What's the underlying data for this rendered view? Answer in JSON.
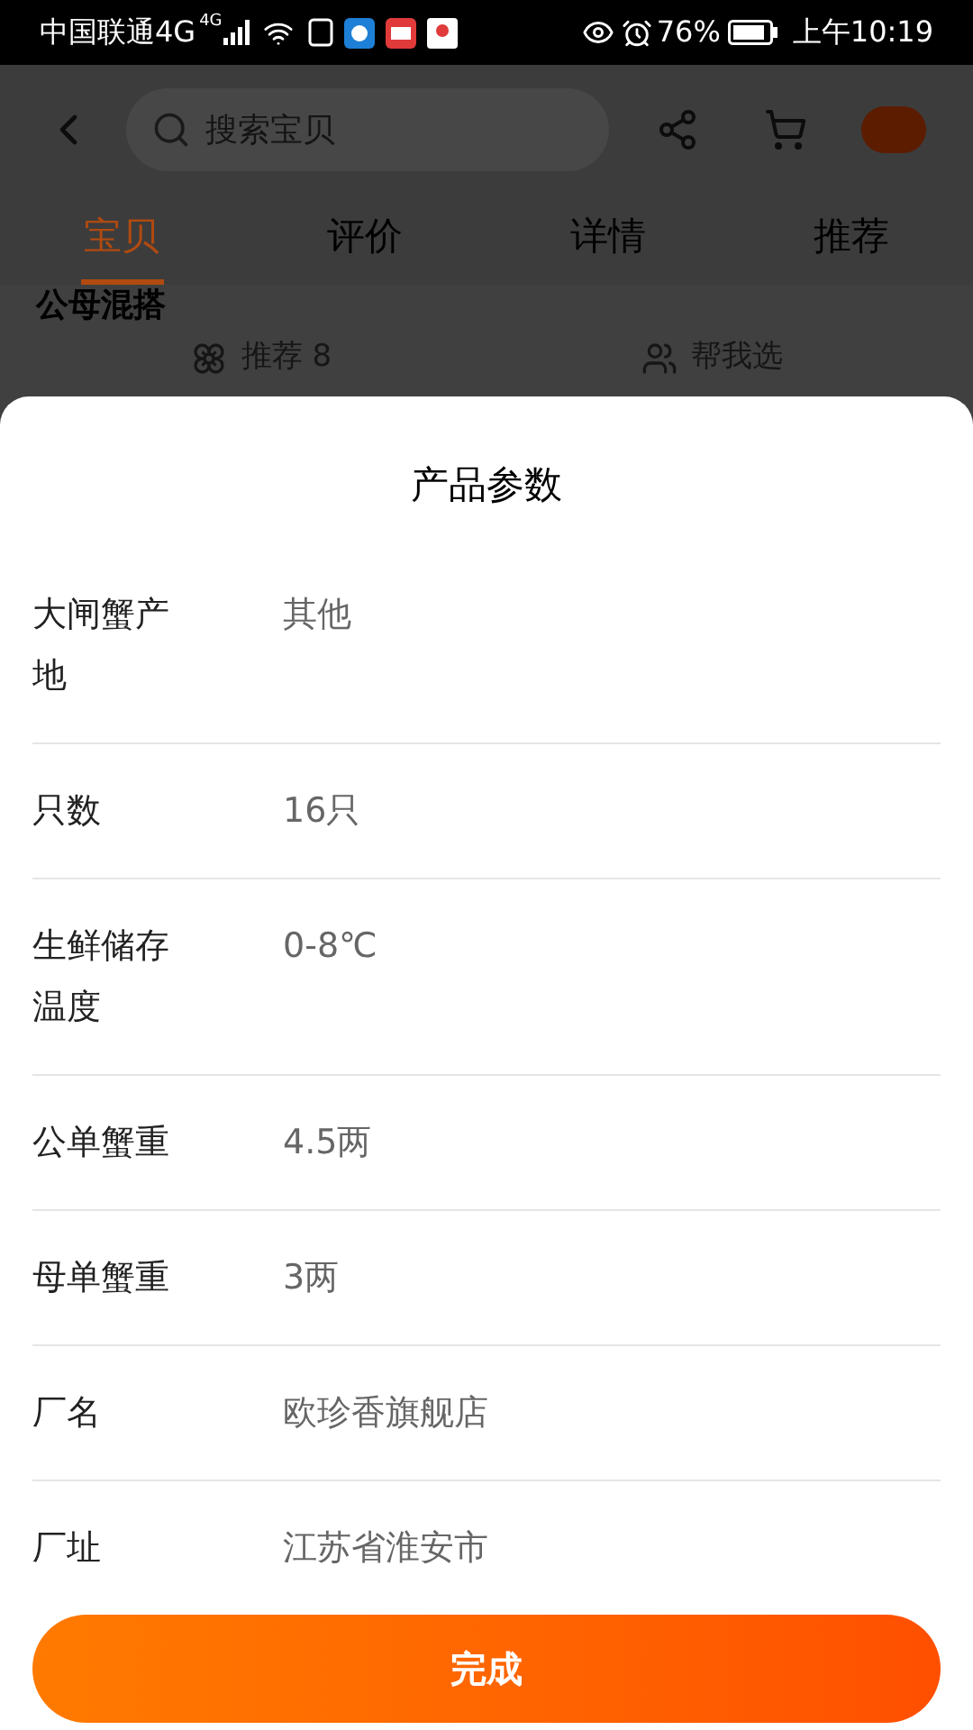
{
  "status_bar": {
    "carrier": "中国联通4G",
    "network": "4G",
    "battery": "76%",
    "time": "上午10:19"
  },
  "header": {
    "search": {
      "placeholder": "搜索宝贝"
    }
  },
  "tabs": [
    {
      "label": "宝贝",
      "selected": true
    },
    {
      "label": "评价",
      "selected": false
    },
    {
      "label": "详情",
      "selected": false
    },
    {
      "label": "推荐",
      "selected": false
    }
  ],
  "behind": {
    "heading": "公母混搭",
    "actions": [
      {
        "label": "推荐 8",
        "kind": "recommend"
      },
      {
        "label": "帮我选",
        "kind": "help"
      }
    ]
  },
  "sheet": {
    "title": "产品参数",
    "params": [
      {
        "label": "大闸蟹产地",
        "value": "其他"
      },
      {
        "label": "只数",
        "value": "16只"
      },
      {
        "label": "生鲜储存温度",
        "value": "0-8℃"
      },
      {
        "label": "公单蟹重",
        "value": "4.5两"
      },
      {
        "label": "母单蟹重",
        "value": "3两"
      },
      {
        "label": "厂名",
        "value": "欧珍香旗舰店"
      },
      {
        "label": "厂址",
        "value": "江苏省淮安市"
      }
    ],
    "button": "完成"
  }
}
